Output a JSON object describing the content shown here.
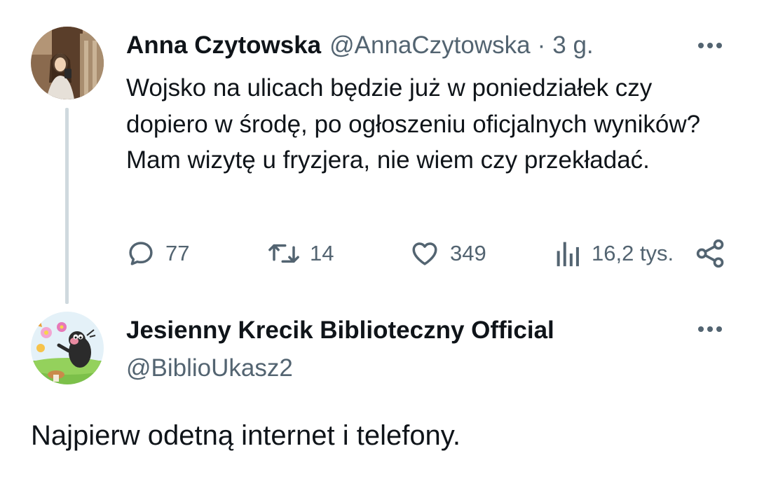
{
  "tweet1": {
    "author_name": "Anna Czytowska",
    "handle": "@AnnaCzytowska",
    "separator": "·",
    "time": "3 g.",
    "text": "Wojsko na ulicach będzie już w poniedziałek czy dopiero w środę, po ogłoszeniu oficjalnych wyników? Mam wizytę u fryzjera, nie wiem czy przekładać.",
    "replies": "77",
    "retweets": "14",
    "likes": "349",
    "views": "16,2 tys."
  },
  "tweet2": {
    "author_name": "Jesienny Krecik Biblioteczny Official",
    "handle": "@BiblioUkasz2",
    "text": "Najpierw odetną internet i telefony."
  },
  "icons": {
    "more": "more-horizontal-icon",
    "reply": "reply-icon",
    "retweet": "retweet-icon",
    "like": "heart-icon",
    "views": "views-chart-icon",
    "share": "share-icon"
  },
  "colors": {
    "text": "#0f1419",
    "muted": "#536471",
    "thread_line": "#cfd9de"
  }
}
